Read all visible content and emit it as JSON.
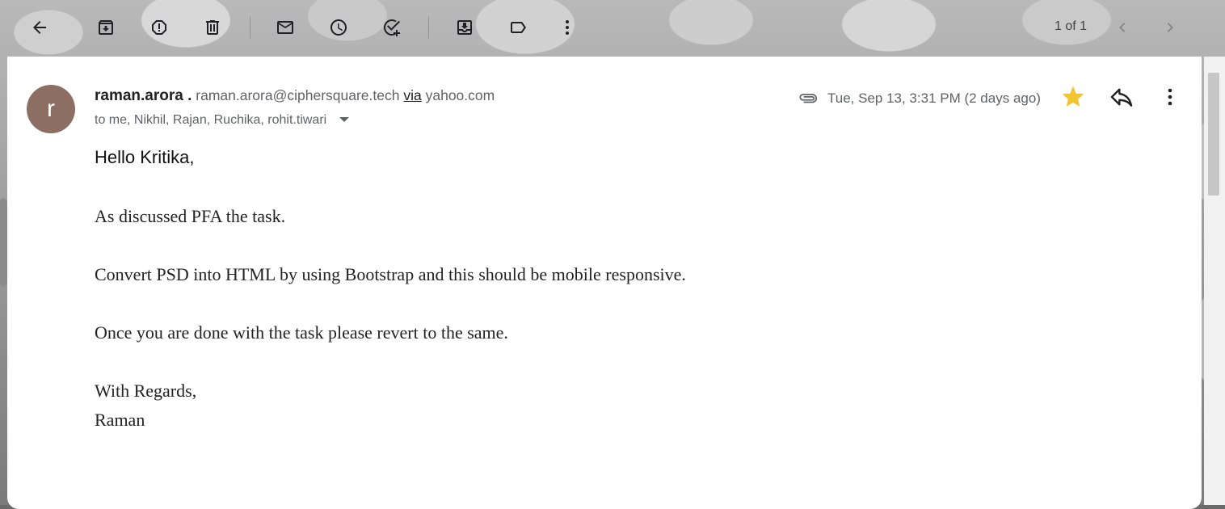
{
  "toolbar": {
    "pager_text": "1 of 1"
  },
  "message": {
    "avatar_letter": "r",
    "sender_name": "raman.arora .",
    "sender_email": "raman.arora@ciphersquare.tech",
    "via_label": "via",
    "via_domain": "yahoo.com",
    "recipients": "to me, Nikhil, Rajan, Ruchika, rohit.tiwari",
    "date": "Tue, Sep 13, 3:31 PM (2 days ago)",
    "starred": true,
    "colors": {
      "avatar": "#8d6e63",
      "star": "#f4c430"
    }
  },
  "body": {
    "greeting": "Hello Kritika,",
    "line1": "As discussed PFA the task.",
    "line2": "Convert PSD into HTML by using Bootstrap and this should be mobile responsive.",
    "line3": "Once you are done with the task please revert to the same.",
    "closing": "With Regards,",
    "signature": "Raman"
  },
  "icons": [
    "back-arrow-icon",
    "archive-icon",
    "report-spam-icon",
    "delete-icon",
    "mark-unread-icon",
    "snooze-icon",
    "add-task-icon",
    "move-to-icon",
    "label-icon",
    "more-vert-icon",
    "chevron-left-icon",
    "chevron-right-icon",
    "attachment-icon",
    "star-icon",
    "reply-icon"
  ]
}
